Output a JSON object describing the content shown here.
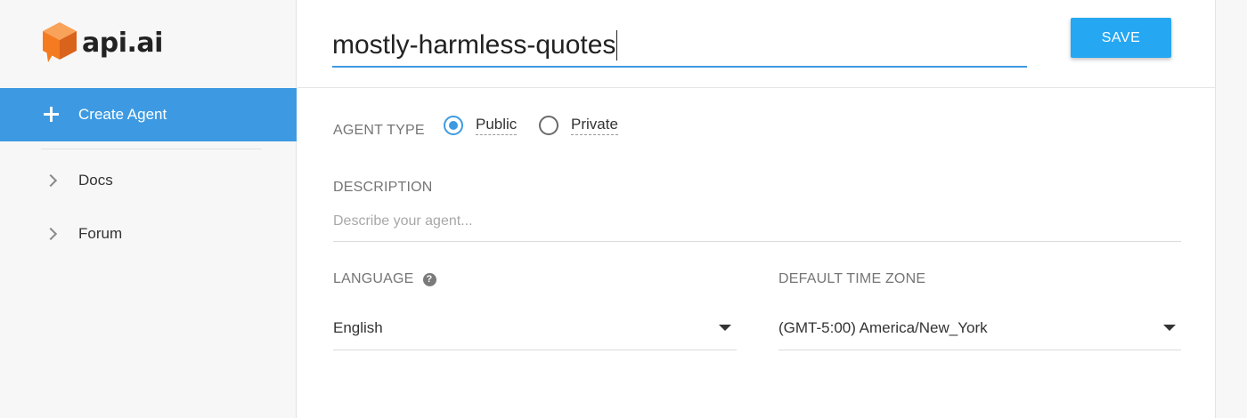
{
  "brand": {
    "name": "api.ai",
    "logo_icon": "api-ai-cube-logo",
    "logo_color": "#f47b20"
  },
  "sidebar": {
    "create_agent": {
      "label": "Create Agent",
      "icon": "plus-icon",
      "background": "#3d9ae2"
    },
    "items": [
      {
        "label": "Docs",
        "icon": "chevron-right-icon"
      },
      {
        "label": "Forum",
        "icon": "chevron-right-icon"
      }
    ]
  },
  "header": {
    "agent_name": "mostly-harmless-quotes",
    "save_label": "SAVE",
    "accent": "#26a7f2"
  },
  "form": {
    "agent_type": {
      "label": "AGENT TYPE",
      "options": [
        {
          "label": "Public",
          "checked": true
        },
        {
          "label": "Private",
          "checked": false
        }
      ]
    },
    "description": {
      "label": "DESCRIPTION",
      "placeholder": "Describe your agent..."
    },
    "language": {
      "label": "LANGUAGE",
      "help_icon": "question-circle-icon",
      "selected": "English"
    },
    "time_zone": {
      "label": "DEFAULT TIME ZONE",
      "selected": "(GMT-5:00) America/New_York"
    }
  }
}
